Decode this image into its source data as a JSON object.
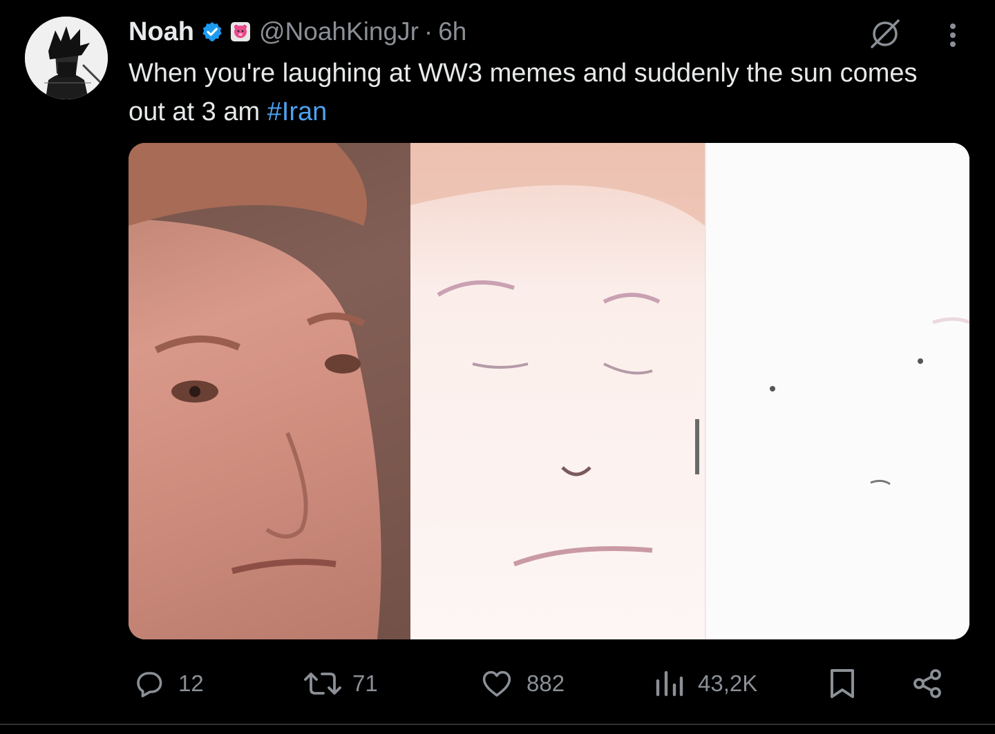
{
  "tweet": {
    "author": {
      "name": "Noah",
      "handle": "@NoahKingJr",
      "separator": "·",
      "time": "6h"
    },
    "text_parts": {
      "main": "When you're laughing at WW3 memes and suddenly the sun comes out at 3 am ",
      "hashtag": "#Iran"
    },
    "media": {
      "type": "image",
      "icon": "meme-three-panel-image"
    },
    "actions": {
      "replies": "12",
      "reposts": "71",
      "likes": "882",
      "views": "43,2K"
    }
  },
  "colors": {
    "background": "#000000",
    "text": "#e7e9ea",
    "secondary": "#8b9096",
    "link": "#4fa1ee",
    "verified": "#1d9bf0"
  }
}
